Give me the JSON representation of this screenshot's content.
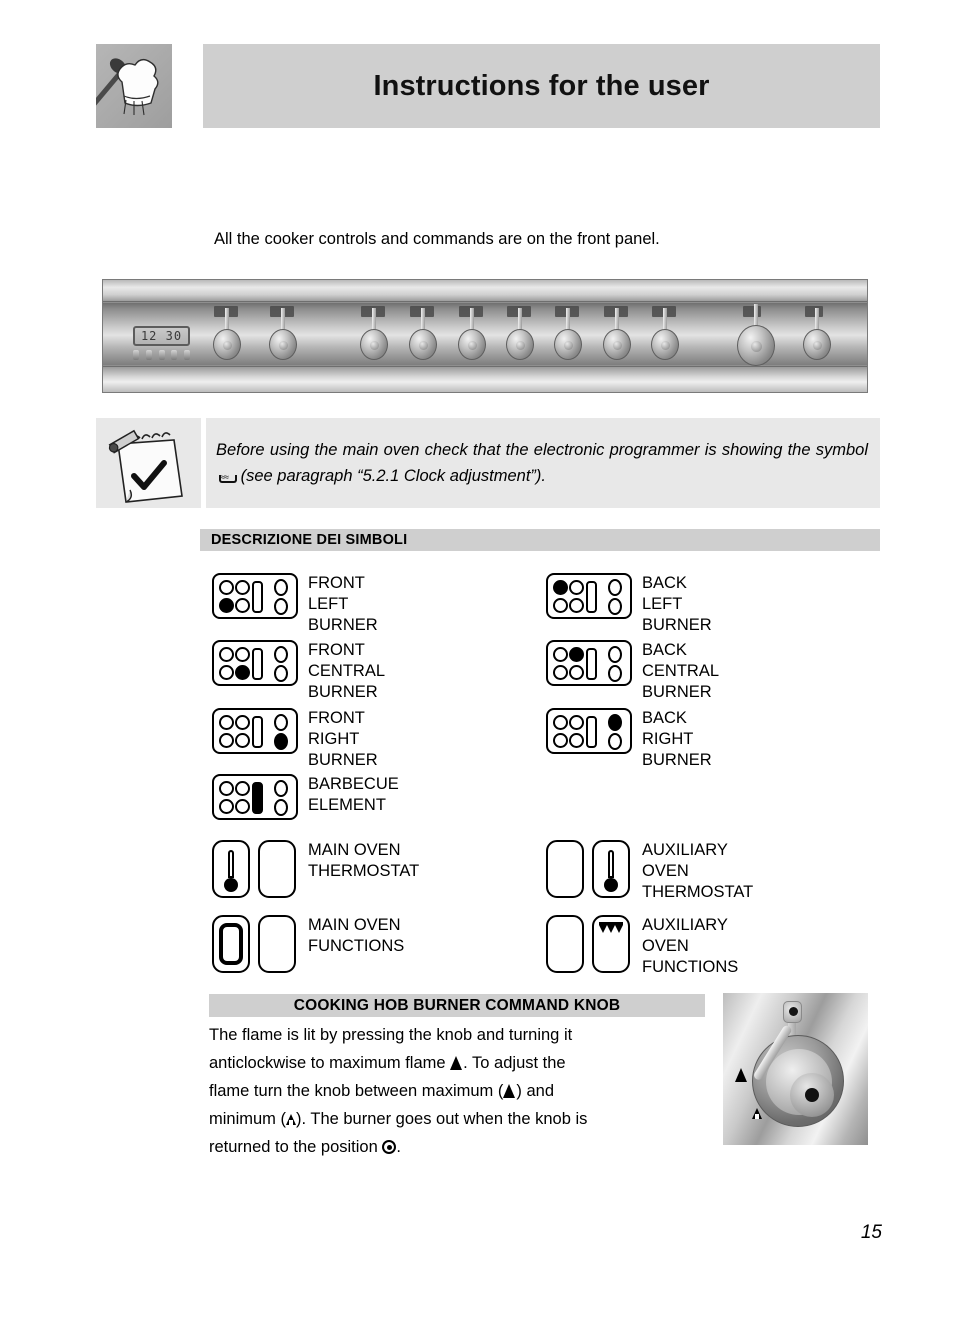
{
  "header": {
    "title": "Instructions for the user",
    "icon": "chef-hat-spoon-icon"
  },
  "intro": {
    "text": "All the cooker controls and commands are on the front panel."
  },
  "control_panel": {
    "alt": "cooker front panel photograph",
    "clock_display": "12 30",
    "knob_count": 11
  },
  "note": {
    "icon": "notepad-check-icon",
    "text_part1": "Before using the main oven check that the electronic programmer is showing the symbol",
    "symbol": "heat-steam-icon",
    "text_part2": "(see paragraph “5.2.1 Clock adjustment”)."
  },
  "symbols_section": {
    "heading": "DESCRIZIONE DEI SIMBOLI",
    "left_column": [
      {
        "label": "FRONT LEFT BURNER",
        "icon": "burner-front-left-icon",
        "active": "bottom-left"
      },
      {
        "label": "FRONT CENTRAL\nBURNER",
        "icon": "burner-front-central-icon",
        "active": "bottom-mid"
      },
      {
        "label": " FRONT RIGHT BURNER",
        "icon": "burner-front-right-icon",
        "active": "bottom-right"
      },
      {
        "label": "BARBECUE ELEMENT",
        "icon": "barbecue-element-icon",
        "active": "bar"
      }
    ],
    "right_column": [
      {
        "label": "BACK LEFT BURNER",
        "icon": "burner-back-left-icon",
        "active": "top-left"
      },
      {
        "label": "BACK CENTRAL\nBURNER",
        "icon": "burner-back-central-icon",
        "active": "top-mid"
      },
      {
        "label": "BACK RIGHT BURNER",
        "icon": "burner-back-right-icon",
        "active": "top-right"
      }
    ],
    "oven_left_column": [
      {
        "label": "MAIN OVEN\nTHERMOSTAT",
        "icon": "main-oven-thermostat-icon"
      },
      {
        "label": "MAIN OVEN\nFUNCTIONS",
        "icon": "main-oven-functions-icon"
      }
    ],
    "oven_right_column": [
      {
        "label": "AUXILIARY OVEN\nTHERMOSTAT",
        "icon": "auxiliary-oven-thermostat-icon"
      },
      {
        "label": "AUXILIARY OVEN\nFUNCTIONS",
        "icon": "auxiliary-oven-functions-icon"
      }
    ]
  },
  "hob_section": {
    "heading": "COOKING HOB BURNER COMMAND KNOB",
    "line1": "The flame is lit by pressing the knob and turning it",
    "line2a": "anticlockwise to maximum flame",
    "line2b": ". To adjust the",
    "line3a": "flame turn the knob between maximum (",
    "line3b": ") and",
    "line4a": "minimum (",
    "line4b": "). The burner goes out when the knob is",
    "line5": "returned to the position",
    "line5b": ".",
    "knob_photo_alt": "cooking hob knob photograph with maximum and minimum flame markings"
  },
  "footer": {
    "page_number": "15"
  },
  "colors": {
    "header_bar": "#cfcfcf",
    "note_bg": "#e8e8e8",
    "section_bar": "#cfcfcf",
    "text": "#000000"
  }
}
